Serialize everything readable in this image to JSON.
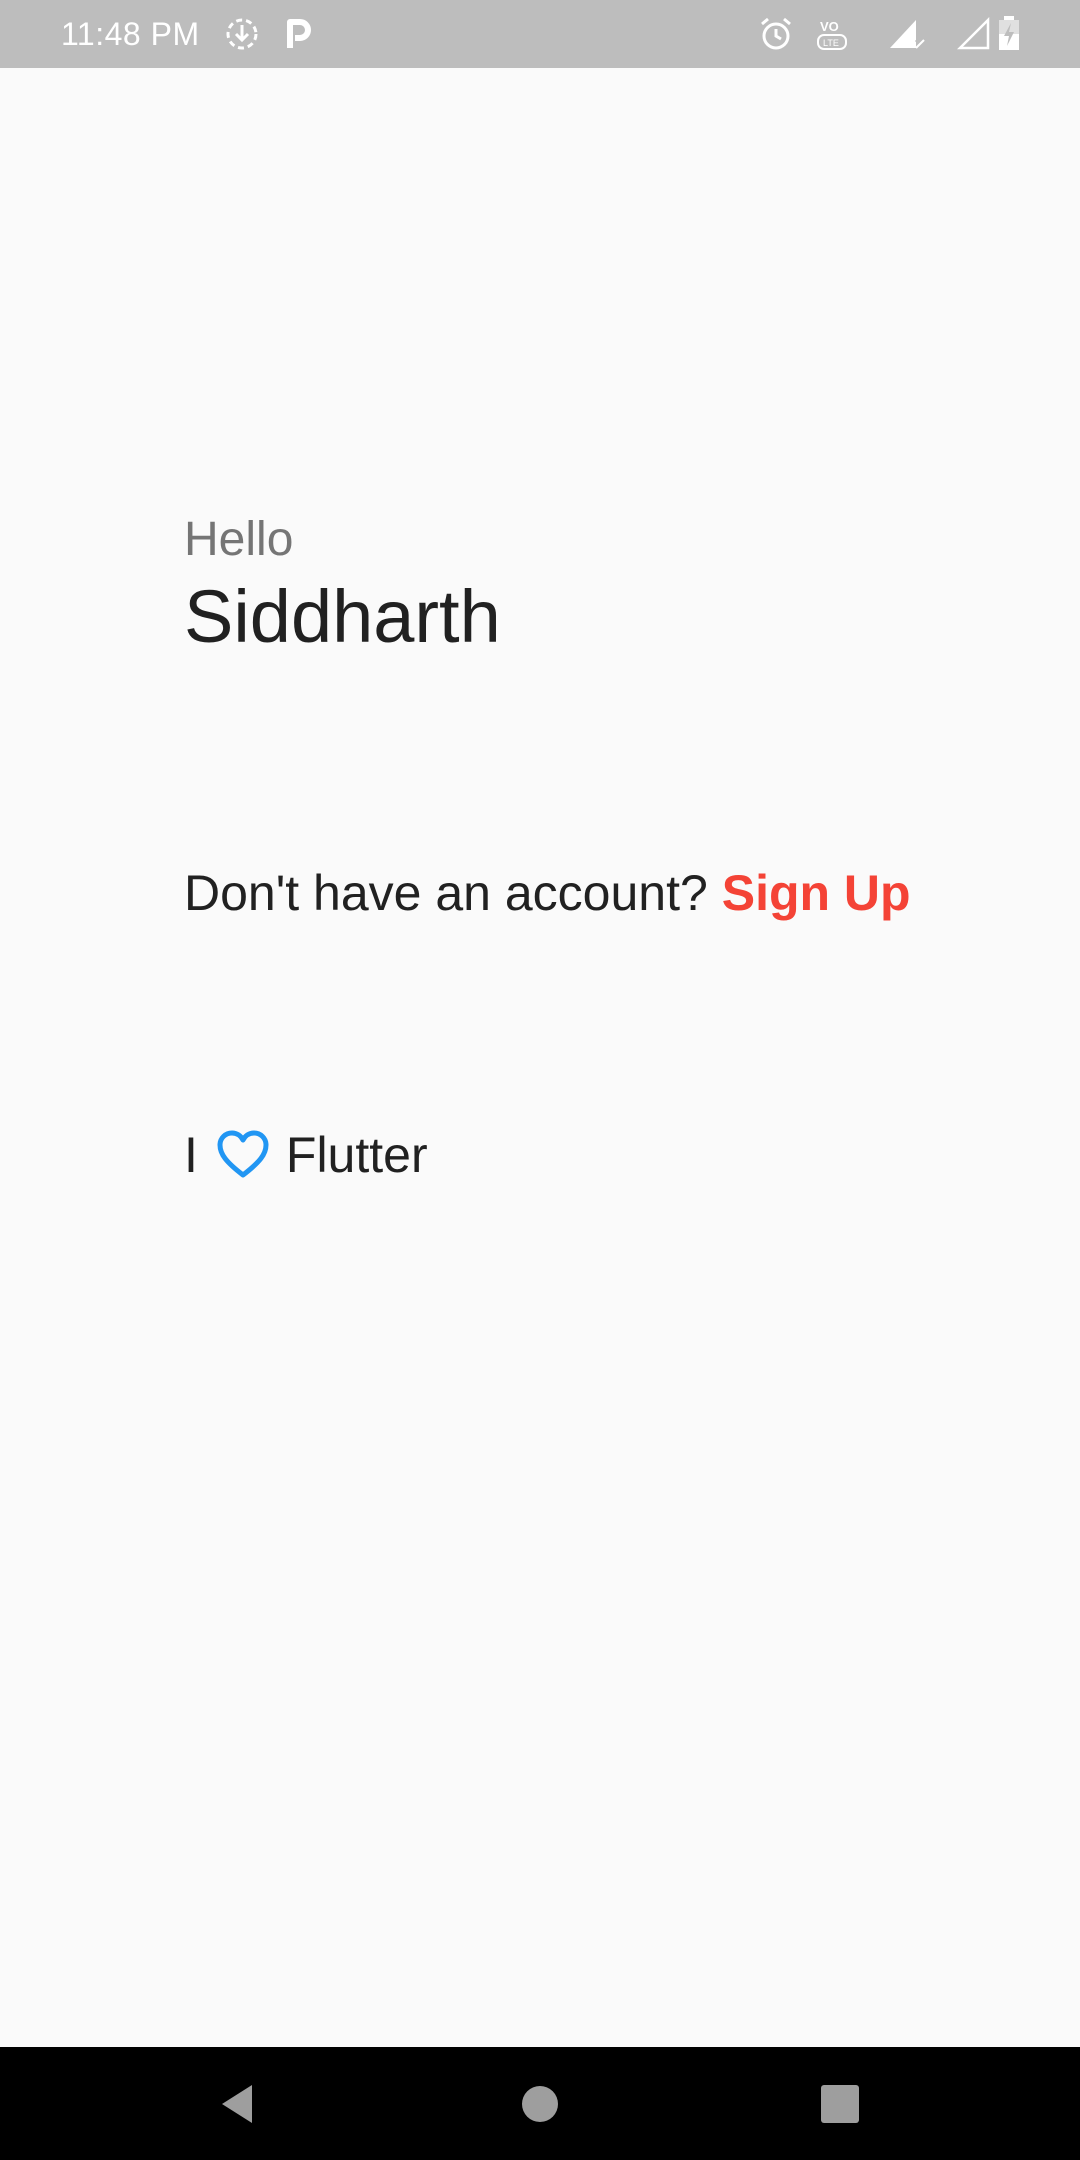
{
  "status_bar": {
    "time": "11:48 PM",
    "icons": [
      "download-icon",
      "parking-icon",
      "alarm-icon",
      "volte-icon",
      "signal-icon",
      "signal-empty-icon",
      "battery-charging-icon"
    ],
    "background": "#bdbdbd"
  },
  "greeting": {
    "hello": "Hello",
    "name": "Siddharth"
  },
  "account": {
    "prompt": "Don't have an account?",
    "signup_label": "Sign Up",
    "signup_color": "#f44336"
  },
  "love": {
    "prefix": "I",
    "icon": "heart-outline-icon",
    "icon_color": "#2196f3",
    "suffix": "Flutter"
  },
  "nav_bar": {
    "buttons": [
      "back-icon",
      "home-icon",
      "recents-icon"
    ]
  }
}
